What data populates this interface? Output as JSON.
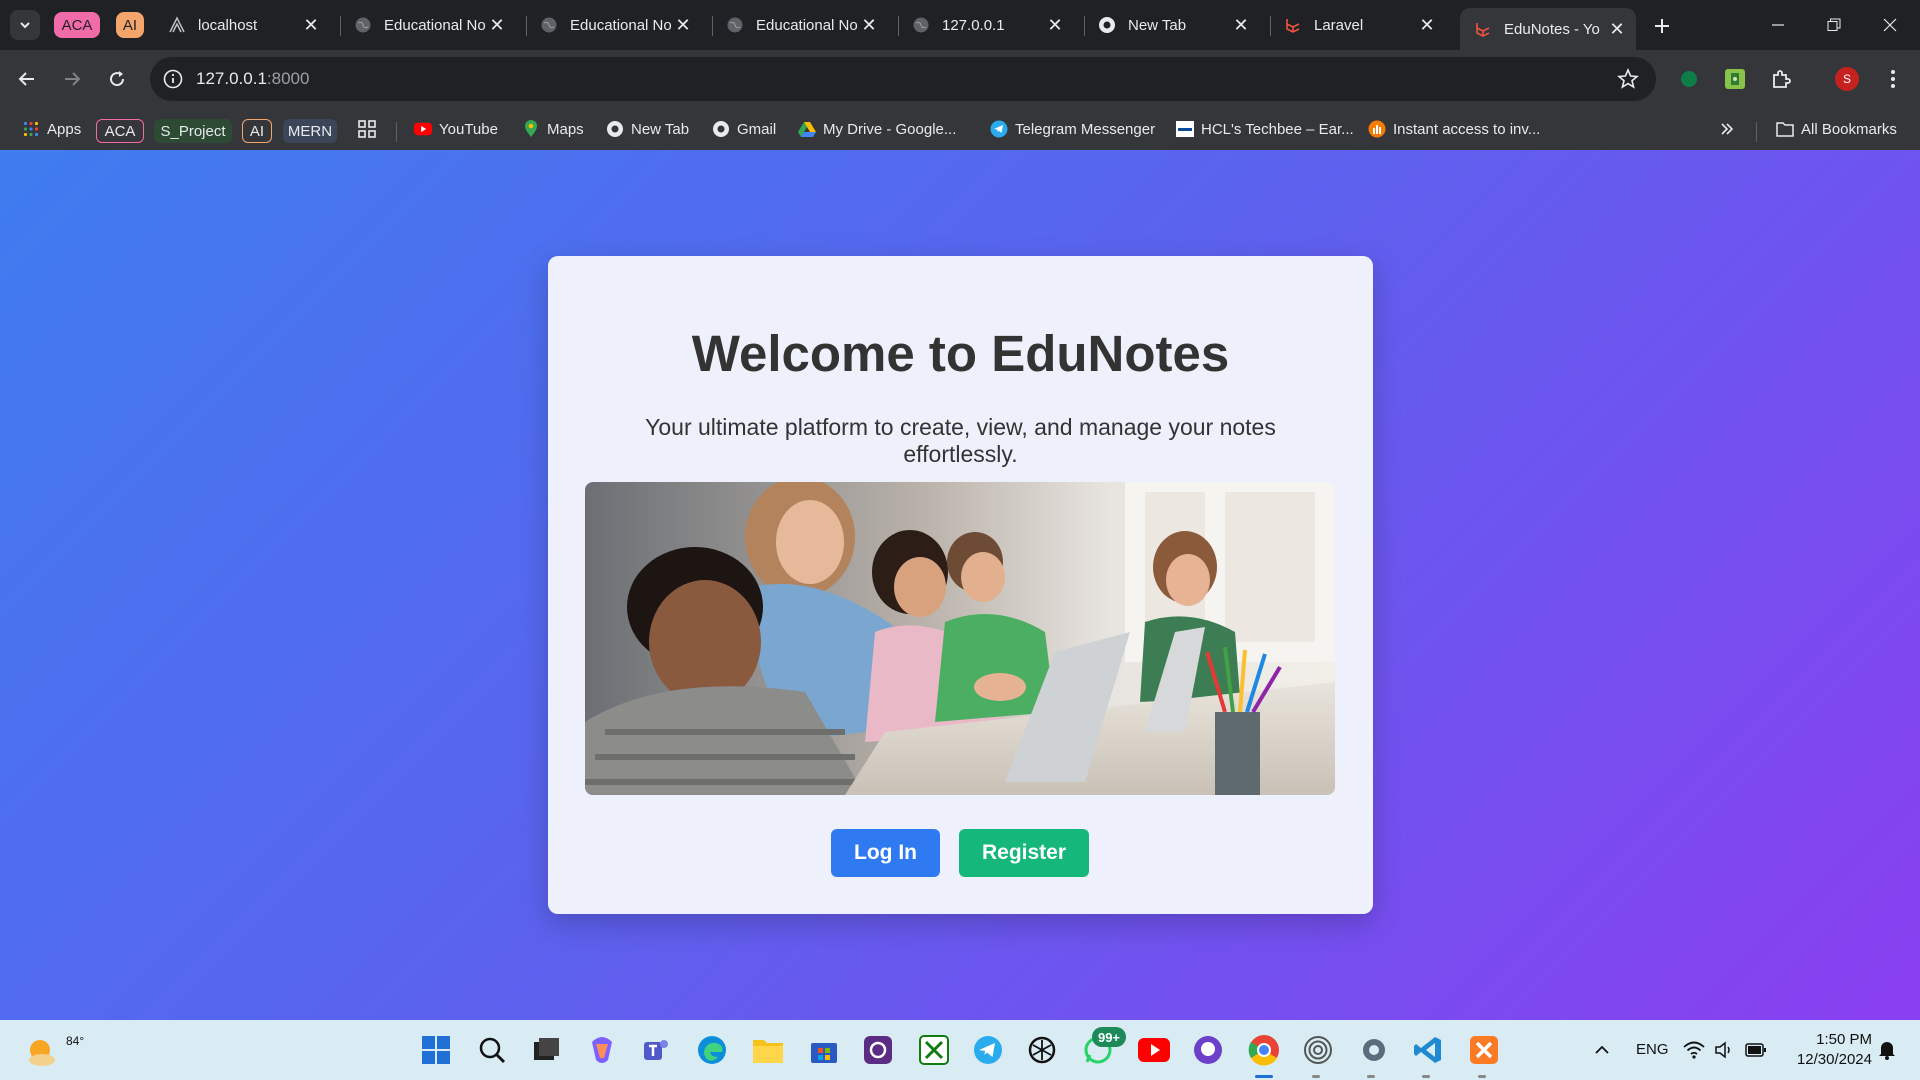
{
  "browser": {
    "tab_groups": [
      {
        "label": "ACA",
        "color": "#f06ba8"
      },
      {
        "label": "AI",
        "color": "#f4a56c"
      }
    ],
    "tabs": [
      {
        "title": "localhost",
        "icon": "localhost-icon"
      },
      {
        "title": "Educational No",
        "icon": "globe-icon"
      },
      {
        "title": "Educational No",
        "icon": "globe-icon"
      },
      {
        "title": "Educational No",
        "icon": "globe-icon"
      },
      {
        "title": "127.0.0.1",
        "icon": "globe-icon"
      },
      {
        "title": "New Tab",
        "icon": "chrome-icon"
      },
      {
        "title": "Laravel",
        "icon": "laravel-icon"
      },
      {
        "title": "EduNotes - Yo",
        "icon": "laravel-icon",
        "active": true
      }
    ],
    "url_host": "127.0.0.1",
    "url_port": ":8000",
    "profile_initial": "S"
  },
  "bookmarks": {
    "apps": "Apps",
    "chips": [
      {
        "label": "ACA",
        "color": "#f06ba8"
      },
      {
        "label": "S_Project",
        "color": "#8fd19e"
      },
      {
        "label": "AI",
        "color": "#f4a56c"
      },
      {
        "label": "MERN",
        "color": "#a8b8e8"
      }
    ],
    "items": [
      {
        "label": "YouTube",
        "icon": "youtube-icon"
      },
      {
        "label": "Maps",
        "icon": "maps-icon"
      },
      {
        "label": "New Tab",
        "icon": "chrome-icon"
      },
      {
        "label": "Gmail",
        "icon": "chrome-icon"
      },
      {
        "label": "My Drive - Google...",
        "icon": "drive-icon"
      },
      {
        "label": "Telegram Messenger",
        "icon": "telegram-icon"
      },
      {
        "label": "HCL's Techbee – Ear...",
        "icon": "hcl-icon"
      },
      {
        "label": "Instant access to inv...",
        "icon": "chart-icon"
      }
    ],
    "all_bookmarks": "All Bookmarks"
  },
  "page": {
    "heading": "Welcome to EduNotes",
    "subtitle": "Your ultimate platform to create, view, and manage your notes effortlessly.",
    "login_label": "Log In",
    "register_label": "Register"
  },
  "taskbar": {
    "temperature": "84°",
    "whatsapp_badge": "99+",
    "language": "ENG",
    "time": "1:50 PM",
    "date": "12/30/2024"
  }
}
